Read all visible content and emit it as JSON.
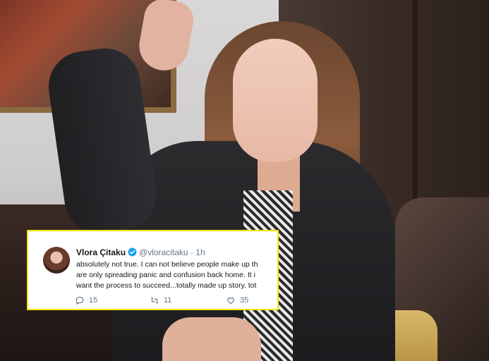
{
  "tweet": {
    "display_name": "Vlora Çitaku",
    "handle": "@vloracitaku",
    "separator": "·",
    "time": "1h",
    "lines": [
      "absolutely not true. I can not believe people make up th",
      "are only spreading panic and confusion back home. It i",
      "want the process to succeed...totally made up story. tot"
    ],
    "replies": "15",
    "retweets": "11",
    "likes": "35",
    "accent_color": "#1da1f2",
    "border_color": "#f5e400"
  },
  "icons": {
    "verified": "verified-badge-icon",
    "reply": "reply-icon",
    "retweet": "retweet-icon",
    "like": "heart-icon"
  }
}
